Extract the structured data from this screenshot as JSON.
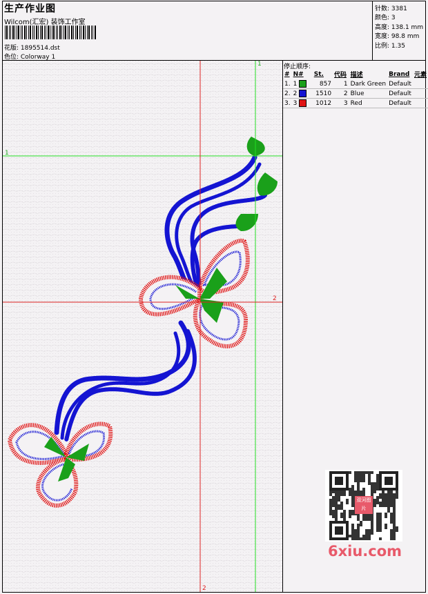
{
  "header": {
    "title": "生产作业图",
    "software": "Wilcom(汇宏) 装饰工作室",
    "design_label": "花版: 1895514.dst",
    "colorway_label": "色位: Colorway 1"
  },
  "stats": [
    {
      "label": "针数:",
      "value": "3381"
    },
    {
      "label": "颜色:",
      "value": "3"
    },
    {
      "label": "高度:",
      "value": "138.1 mm"
    },
    {
      "label": "宽度:",
      "value": "98.8 mm"
    },
    {
      "label": "比例:",
      "value": "1.35"
    }
  ],
  "stop_sequence": {
    "title": "停止顺序:",
    "columns": [
      "#",
      "N#",
      "St.",
      "代码",
      "描述",
      "Brand",
      "元素"
    ],
    "rows": [
      {
        "index": "1.",
        "needle": "1",
        "color": "#1aa01a",
        "stitches": "857",
        "code": "1",
        "description": "Dark Green",
        "brand": "Default"
      },
      {
        "index": "2.",
        "needle": "2",
        "color": "#1414d2",
        "stitches": "1510",
        "code": "2",
        "description": "Blue",
        "brand": "Default"
      },
      {
        "index": "3.",
        "needle": "3",
        "color": "#e01414",
        "stitches": "1012",
        "code": "3",
        "description": "Red",
        "brand": "Default"
      }
    ]
  },
  "axis_labels": {
    "green_v": "1",
    "green_h": "1",
    "red_h": "2",
    "red_v": "2"
  },
  "watermark": {
    "site": "6xiu.com",
    "stamp": "双河图片"
  },
  "colors": {
    "green_thread": "#1aa01a",
    "blue_thread": "#1414d2",
    "red_thread": "#e01414",
    "guide_green": "#22dd22",
    "guide_red": "#dd2222"
  }
}
